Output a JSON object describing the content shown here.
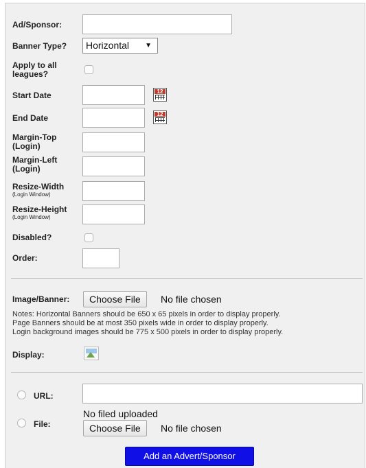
{
  "form": {
    "ad_sponsor_label": "Ad/Sponsor:",
    "ad_sponsor_value": "",
    "banner_type_label": "Banner Type?",
    "banner_type_value": "Horizontal",
    "apply_all_label": "Apply to all leagues?",
    "start_date_label": "Start Date",
    "start_date_value": "",
    "calendar_icon_text": "12",
    "end_date_label": "End Date",
    "end_date_value": "",
    "margin_top_label": "Margin-Top",
    "margin_top_sub": "(Login)",
    "margin_left_label": "Margin-Left",
    "margin_left_sub": "(Login)",
    "resize_width_label": "Resize-Width",
    "resize_width_sub": "(Login Window)",
    "resize_height_label": "Resize-Height",
    "resize_height_sub": "(Login Window)",
    "disabled_label": "Disabled?",
    "order_label": "Order:"
  },
  "image": {
    "label": "Image/Banner:",
    "choose_file": "Choose File",
    "no_file": "No file chosen",
    "notes": [
      "Notes: Horizontal Banners should be 650 x 65 pixels in order to display properly.",
      "Page Banners should be at most 350 pixels wide in order to display properly.",
      "Login background images should be 775 x 500 pixels in order to display properly."
    ],
    "display_label": "Display:"
  },
  "link": {
    "url_label": "URL:",
    "url_value": "",
    "file_label": "File:",
    "no_uploaded": "No filed uploaded",
    "choose_file": "Choose File",
    "no_file": "No file chosen"
  },
  "submit_label": "Add an Advert/Sponsor"
}
